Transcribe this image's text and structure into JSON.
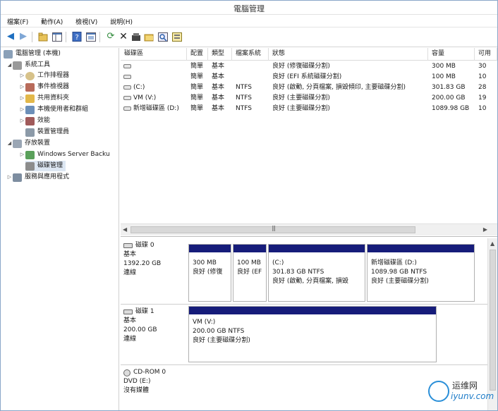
{
  "window": {
    "title": "電腦管理"
  },
  "menu": [
    "檔案(F)",
    "動作(A)",
    "檢視(V)",
    "說明(H)"
  ],
  "toolbar": {
    "icons": [
      "back-icon",
      "forward-icon",
      "up-folder-icon",
      "show-hide-tree-icon",
      "help-icon",
      "console-icon",
      "refresh-icon",
      "delete-icon",
      "properties-icon",
      "open-icon",
      "search-icon",
      "export-icon"
    ]
  },
  "tree": [
    {
      "label": "電腦管理 (本機)",
      "level": 0,
      "arrow": "",
      "icon": "computer-icon"
    },
    {
      "label": "系統工具",
      "level": 1,
      "arrow": "◢",
      "icon": "tools-icon"
    },
    {
      "label": "工作排程器",
      "level": 2,
      "arrow": "▷",
      "icon": "clock-icon"
    },
    {
      "label": "事件檢視器",
      "level": 2,
      "arrow": "▷",
      "icon": "event-icon"
    },
    {
      "label": "共用資料夾",
      "level": 2,
      "arrow": "▷",
      "icon": "folder-icon"
    },
    {
      "label": "本機使用者和群組",
      "level": 2,
      "arrow": "▷",
      "icon": "users-icon"
    },
    {
      "label": "效能",
      "level": 2,
      "arrow": "▷",
      "icon": "performance-icon"
    },
    {
      "label": "裝置管理員",
      "level": 2,
      "arrow": "",
      "icon": "device-icon"
    },
    {
      "label": "存放裝置",
      "level": 1,
      "arrow": "◢",
      "icon": "storage-icon"
    },
    {
      "label": "Windows Server Backu",
      "level": 2,
      "arrow": "▷",
      "icon": "backup-icon"
    },
    {
      "label": "磁碟管理",
      "level": 2,
      "arrow": "",
      "icon": "disk-icon"
    },
    {
      "label": "服務與應用程式",
      "level": 1,
      "arrow": "▷",
      "icon": "services-icon"
    }
  ],
  "volume_list": {
    "columns": [
      "磁碟區",
      "配置",
      "類型",
      "檔案系統",
      "狀態",
      "容量",
      "可用"
    ],
    "rows": [
      {
        "volume": "",
        "layout": "簡單",
        "type": "基本",
        "fs": "",
        "status": "良好 (修復磁碟分割)",
        "capacity": "300 MB",
        "free": "30"
      },
      {
        "volume": "",
        "layout": "簡單",
        "type": "基本",
        "fs": "",
        "status": "良好 (EFI 系統磁碟分割)",
        "capacity": "100 MB",
        "free": "10"
      },
      {
        "volume": "(C:)",
        "layout": "簡單",
        "type": "基本",
        "fs": "NTFS",
        "status": "良好 (啟動, 分頁檔案, 損毀傾印, 主要磁碟分割)",
        "capacity": "301.83 GB",
        "free": "28"
      },
      {
        "volume": "VM (V:)",
        "layout": "簡單",
        "type": "基本",
        "fs": "NTFS",
        "status": "良好 (主要磁碟分割)",
        "capacity": "200.00 GB",
        "free": "19"
      },
      {
        "volume": "新增磁碟區 (D:)",
        "layout": "簡單",
        "type": "基本",
        "fs": "NTFS",
        "status": "良好 (主要磁碟分割)",
        "capacity": "1089.98 GB",
        "free": "10"
      }
    ]
  },
  "disks": [
    {
      "name": "磁碟 0",
      "kind": "基本",
      "size": "1392.20 GB",
      "state": "連線",
      "partitions": [
        {
          "line1": "",
          "line2": "300 MB",
          "line3": "良好 (修復"
        },
        {
          "line1": "",
          "line2": "100 MB",
          "line3": "良好 (EF"
        },
        {
          "line1": "(C:)",
          "line2": "301.83 GB NTFS",
          "line3": "良好 (啟動, 分頁檔案, 損毀"
        },
        {
          "line1": "新增磁碟區 (D:)",
          "line2": "1089.98 GB NTFS",
          "line3": "良好 (主要磁碟分割)"
        }
      ]
    },
    {
      "name": "磁碟 1",
      "kind": "基本",
      "size": "200.00 GB",
      "state": "連線",
      "partitions": [
        {
          "line1": "VM (V:)",
          "line2": "200.00 GB NTFS",
          "line3": "良好 (主要磁碟分割)"
        }
      ]
    },
    {
      "name": "CD-ROM 0",
      "kind": "DVD (E:)",
      "size": "",
      "state": "沒有媒體",
      "partitions": []
    }
  ],
  "watermark": {
    "text1": "运维网",
    "text2": "iyunv.com"
  },
  "colors": {
    "partition_bar": "#161c7a",
    "selection": "#dde7f3",
    "accent": "#2a8fd8"
  }
}
